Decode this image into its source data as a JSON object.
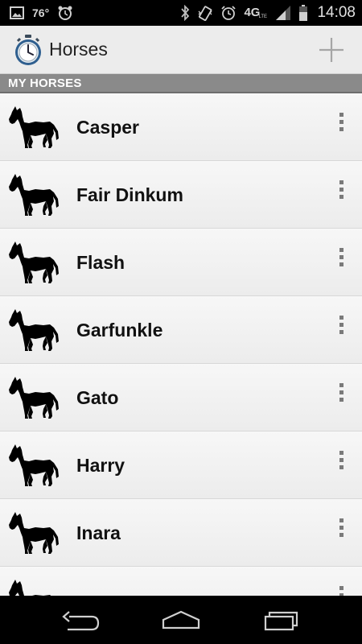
{
  "status_bar": {
    "temperature": "76°",
    "network": "4G",
    "network_sub": "LTE",
    "time": "14:08"
  },
  "action_bar": {
    "title": "Horses",
    "app_icon": "stopwatch-icon",
    "add_icon": "plus-icon"
  },
  "section": {
    "header": "MY HORSES"
  },
  "horses": [
    {
      "name": "Casper"
    },
    {
      "name": "Fair Dinkum"
    },
    {
      "name": "Flash"
    },
    {
      "name": "Garfunkle"
    },
    {
      "name": "Gato"
    },
    {
      "name": "Harry"
    },
    {
      "name": "Inara"
    }
  ],
  "nav": {
    "back_icon": "back-icon",
    "home_icon": "home-icon",
    "recents_icon": "recents-icon"
  },
  "colors": {
    "action_bar_bg": "#ececec",
    "section_header_bg": "#8a8a8a",
    "row_bg": "#f3f3f3",
    "status_bar_bg": "#000000"
  }
}
